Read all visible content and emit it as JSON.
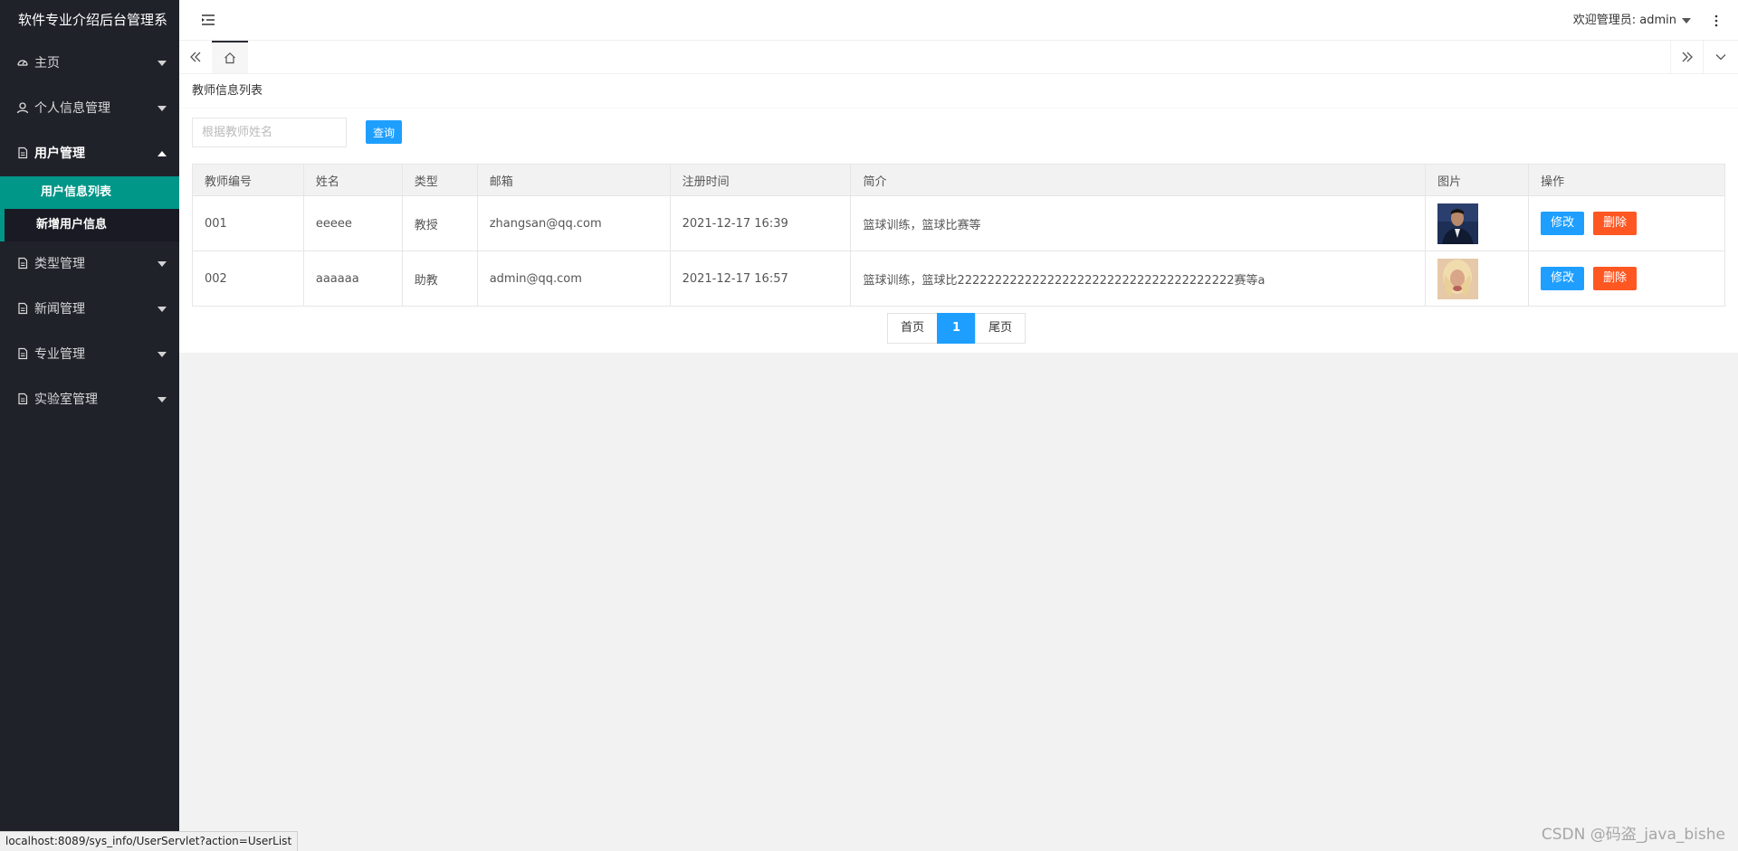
{
  "sidebar": {
    "brand": "软件专业介绍后台管理系",
    "items": [
      {
        "label": "主页",
        "icon": "dashboard-icon",
        "open": false
      },
      {
        "label": "个人信息管理",
        "icon": "user-icon",
        "open": false
      },
      {
        "label": "用户管理",
        "icon": "file-icon",
        "open": true,
        "children": [
          {
            "label": "用户信息列表",
            "active": true
          },
          {
            "label": "新增用户信息",
            "active": false
          }
        ]
      },
      {
        "label": "类型管理",
        "icon": "file-icon",
        "open": false
      },
      {
        "label": "新闻管理",
        "icon": "file-icon",
        "open": false
      },
      {
        "label": "专业管理",
        "icon": "file-icon",
        "open": false
      },
      {
        "label": "实验室管理",
        "icon": "file-icon",
        "open": false
      }
    ]
  },
  "header": {
    "user_label": "欢迎管理员: admin"
  },
  "content": {
    "title": "教师信息列表",
    "search": {
      "placeholder": "根据教师姓名",
      "button": "查询"
    },
    "table": {
      "columns": [
        "教师编号",
        "姓名",
        "类型",
        "邮箱",
        "注册时间",
        "简介",
        "图片",
        "操作"
      ],
      "rows": [
        {
          "id": "001",
          "name": "eeeee",
          "type": "教授",
          "email": "zhangsan@qq.com",
          "time": "2021-12-17 16:39",
          "intro": "篮球训练，篮球比赛等",
          "photo": "male-portrait"
        },
        {
          "id": "002",
          "name": "aaaaaa",
          "type": "助教",
          "email": "admin@qq.com",
          "time": "2021-12-17 16:57",
          "intro": "篮球训练，篮球比2222222222222222222222222222222222222赛等a",
          "photo": "blonde-portrait"
        }
      ],
      "edit_label": "修改",
      "delete_label": "删除"
    },
    "pager": {
      "first": "首页",
      "current": "1",
      "last": "尾页"
    }
  },
  "statusbar": "localhost:8089/sys_info/UserServlet?action=UserList",
  "watermark": "CSDN @码盗_java_bishe",
  "colors": {
    "sidebar": "#20222a",
    "active": "#009688",
    "primary": "#1e9fff",
    "danger": "#ff5722"
  }
}
